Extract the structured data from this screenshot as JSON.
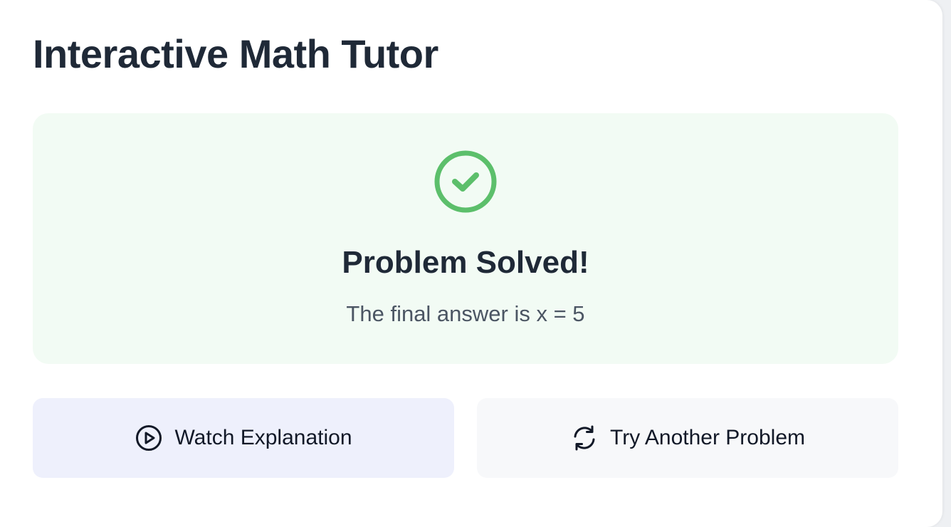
{
  "header": {
    "title": "Interactive Math Tutor"
  },
  "result": {
    "icon": "check-circle-icon",
    "title": "Problem Solved!",
    "message": "The final answer is x = 5",
    "accent_color": "#5cbf6b",
    "panel_color": "#f2fbf4"
  },
  "actions": {
    "watch": {
      "label": "Watch Explanation",
      "icon": "play-circle-icon"
    },
    "retry": {
      "label": "Try Another Problem",
      "icon": "refresh-icon"
    }
  }
}
